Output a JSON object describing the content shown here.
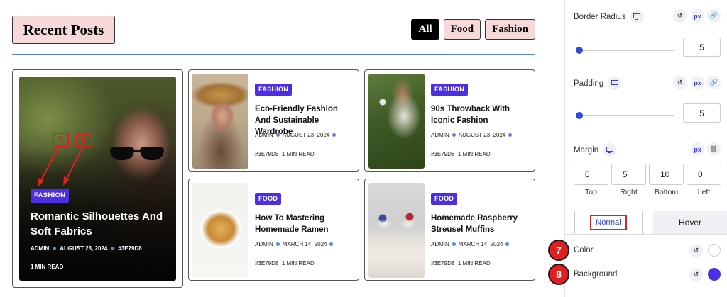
{
  "preview": {
    "section_title": "Recent Posts",
    "filters": [
      "All",
      "Food",
      "Fashion"
    ],
    "active_filter": "All",
    "featured": {
      "badge": "FASHION",
      "title": "Romantic Silhouettes And Soft Fabrics",
      "author": "ADMIN",
      "date": "AUGUST 23, 2024",
      "tag": "#3E79D8",
      "read_time": "1 MIN READ",
      "annotation_7": "7",
      "annotation_8": "8"
    },
    "posts": [
      {
        "badge": "FASHION",
        "title": "Eco-Friendly Fashion And Sustainable Wardrobe",
        "author": "ADMIN",
        "date": "AUGUST 23, 2024",
        "tag": "#3E79D8",
        "read_time": "1 MIN READ"
      },
      {
        "badge": "FASHION",
        "title": "90s Throwback With Iconic Fashion",
        "author": "ADMIN",
        "date": "AUGUST 23, 2024",
        "tag": "#3E79D8",
        "read_time": "1 MIN READ"
      },
      {
        "badge": "FOOD",
        "title": "How To Mastering Homemade Ramen",
        "author": "ADMIN",
        "date": "MARCH 14, 2024",
        "tag": "#3E79D8",
        "read_time": "1 MIN READ"
      },
      {
        "badge": "FOOD",
        "title": "Homemade Raspberry Streusel Muffins",
        "author": "ADMIN",
        "date": "MARCH 14, 2024",
        "tag": "#3E79D8",
        "read_time": "1 MIN READ"
      }
    ]
  },
  "panel": {
    "border_radius": {
      "label": "Border Radius",
      "unit": "px",
      "value": "5"
    },
    "padding": {
      "label": "Padding",
      "unit": "px",
      "value": "5"
    },
    "margin": {
      "label": "Margin",
      "unit": "px",
      "top": "0",
      "right": "5",
      "bottom": "10",
      "left": "0",
      "captions": {
        "top": "Top",
        "right": "Right",
        "bottom": "Bottom",
        "left": "Left"
      }
    },
    "tabs": {
      "normal": "Normal",
      "hover": "Hover"
    },
    "color": {
      "label": "Color",
      "step": "7",
      "value": "#ffffff"
    },
    "background": {
      "label": "Background",
      "step": "8",
      "value": "#4d2fe3"
    }
  },
  "colors": {
    "accent": "#4d2fe3",
    "pink": "#f8d9d9",
    "annotation_red": "#e02020",
    "divider_blue": "#4f8ae0"
  }
}
